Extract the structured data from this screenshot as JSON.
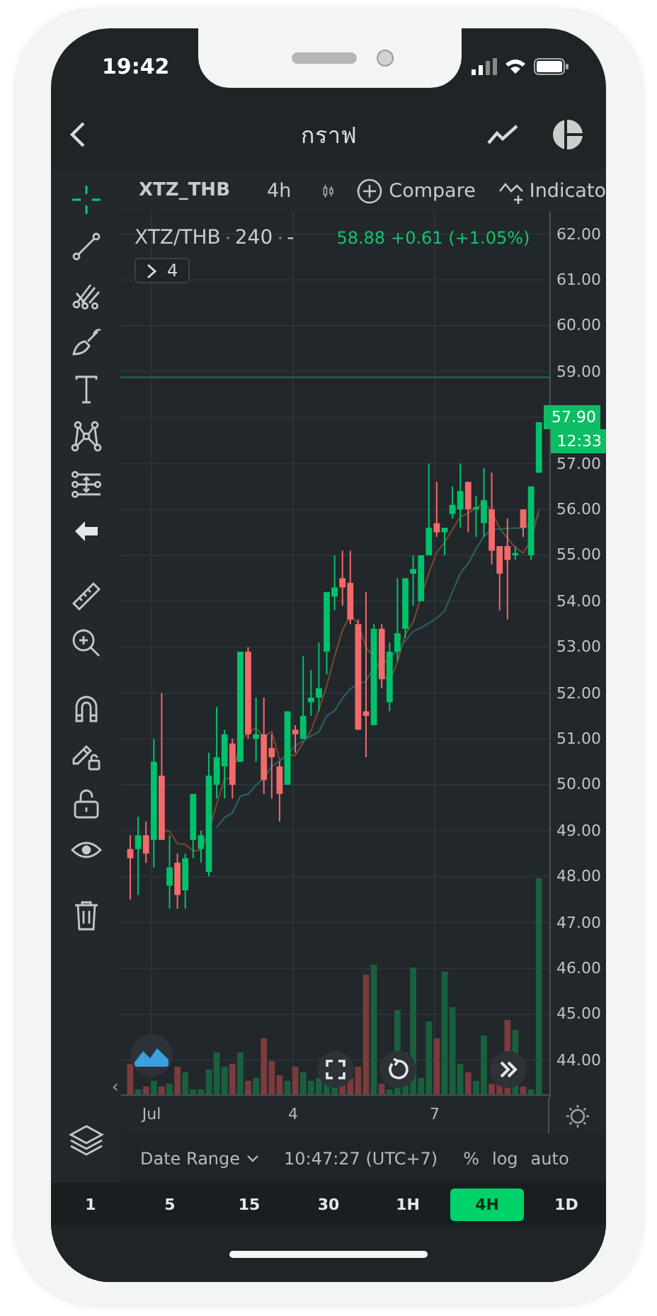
{
  "status_bar": {
    "time": "19:42"
  },
  "header": {
    "title": "กราฟ"
  },
  "toolbar": {
    "symbol": "XTZ_THB",
    "interval": "4h",
    "compare": "Compare",
    "indicators": "Indicato"
  },
  "legend": {
    "symbol": "XTZ/THB",
    "interval": "240",
    "value": "-",
    "price": "58.88",
    "change": "+0.61 (+1.05%)",
    "hidden_count": "4"
  },
  "sidebar": {
    "tools": [
      {
        "kind": "crosshair",
        "selected": true
      },
      {
        "kind": "trend-line",
        "selected": false
      },
      {
        "kind": "pitchfork",
        "selected": false
      },
      {
        "kind": "brush",
        "selected": false
      },
      {
        "kind": "text",
        "selected": false
      },
      {
        "kind": "pattern",
        "selected": false
      },
      {
        "kind": "measure",
        "selected": false
      },
      {
        "kind": "arrow",
        "selected": false
      },
      {
        "kind": "ruler",
        "selected": false
      },
      {
        "kind": "zoom",
        "selected": false
      },
      {
        "kind": "magnet",
        "selected": false
      },
      {
        "kind": "lock-drawing",
        "selected": false
      },
      {
        "kind": "unlock",
        "selected": false
      },
      {
        "kind": "eye",
        "selected": false
      },
      {
        "kind": "trash",
        "selected": false
      }
    ]
  },
  "price_axis": {
    "ticks_upper": [
      "62.00",
      "61.00",
      "60.00",
      "59.00"
    ],
    "ticks_lower": [
      "57.00",
      "56.00",
      "55.00",
      "54.00",
      "53.00",
      "52.00",
      "51.00",
      "50.00",
      "49.00",
      "48.00",
      "47.00",
      "46.00",
      "45.00",
      "44.00"
    ],
    "last_price": "57.90",
    "countdown": "12:33"
  },
  "chart_controls": {
    "scroll_back": "‹"
  },
  "time_axis": [
    "Jul",
    "4",
    "7"
  ],
  "bottom_bar": {
    "date_range": "Date Range",
    "time": "10:47:27 (UTC+7)",
    "options": [
      "%",
      "log",
      "auto"
    ]
  },
  "intervals": [
    {
      "label": "1",
      "selected": false
    },
    {
      "label": "5",
      "selected": false
    },
    {
      "label": "15",
      "selected": false
    },
    {
      "label": "30",
      "selected": false
    },
    {
      "label": "1H",
      "selected": false
    },
    {
      "label": "4H",
      "selected": true
    },
    {
      "label": "1D",
      "selected": false
    }
  ]
}
